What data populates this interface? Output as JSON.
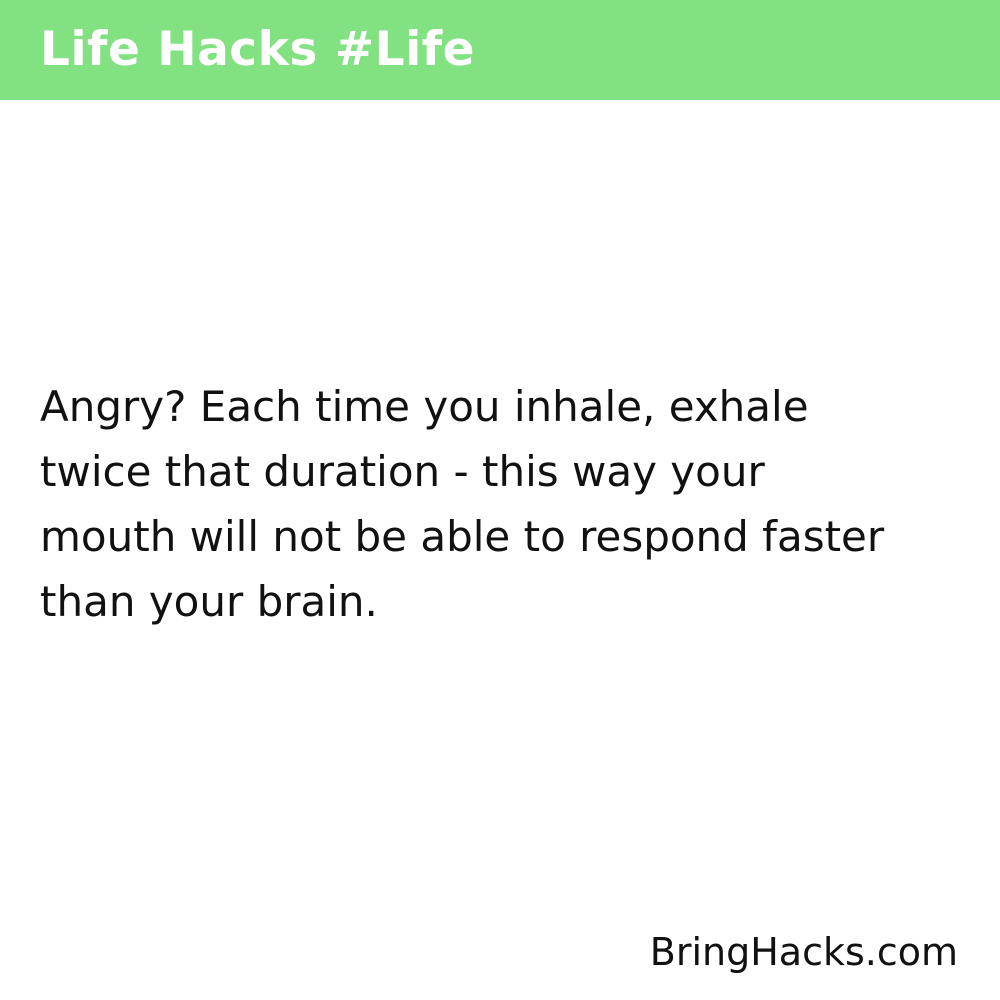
{
  "header": {
    "title": "Life Hacks #Life",
    "background_color": "#82e180",
    "text_color": "#ffffff"
  },
  "hack": {
    "lines": [
      "Angry? Each time you inhale, exhale",
      "twice that duration - this way your",
      "mouth will not be able to respond faster",
      "than your brain."
    ]
  },
  "footer": {
    "site": "BringHacks.com"
  }
}
